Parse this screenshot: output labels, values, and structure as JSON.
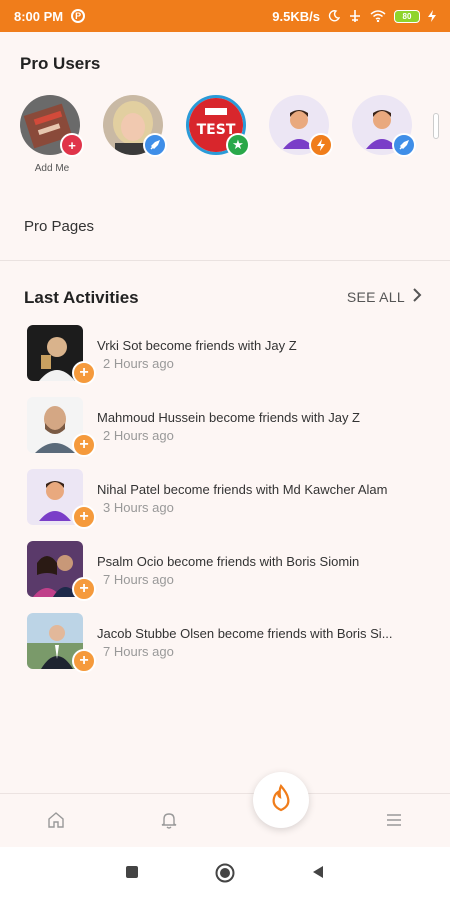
{
  "status_bar": {
    "time": "8:00 PM",
    "network_speed": "9.5KB/s",
    "battery": "80"
  },
  "pro_users": {
    "title": "Pro Users",
    "items": [
      {
        "label": "Add Me",
        "badge": "plus",
        "badge_color": "#e0344a"
      },
      {
        "label": "",
        "badge": "rocket",
        "badge_color": "#3f8ee8"
      },
      {
        "label": "",
        "badge": "star",
        "badge_color": "#2aa84a"
      },
      {
        "label": "",
        "badge": "bolt",
        "badge_color": "#f07d1b"
      },
      {
        "label": "",
        "badge": "rocket",
        "badge_color": "#3f8ee8"
      }
    ]
  },
  "pro_pages": {
    "label": "Pro Pages"
  },
  "last_activities": {
    "title": "Last Activities",
    "see_all": "SEE ALL",
    "items": [
      {
        "text": "Vrki Sot become friends with Jay Z",
        "time": "2 Hours ago"
      },
      {
        "text": "Mahmoud Hussein become friends with Jay Z",
        "time": "2 Hours ago"
      },
      {
        "text": "Nihal Patel become friends with Md Kawcher Alam",
        "time": "3 Hours ago"
      },
      {
        "text": "Psalm Ocio become friends with Boris Siomin",
        "time": "7 Hours ago"
      },
      {
        "text": "Jacob Stubbe Olsen become friends with Boris Si...",
        "time": "7 Hours ago"
      }
    ]
  },
  "bottom_nav": {
    "icons": [
      "home-icon",
      "bell-icon",
      "flame-icon",
      "menu-icon"
    ]
  },
  "colors": {
    "accent": "#f07d1b",
    "plus_badge": "#f59a3c"
  }
}
